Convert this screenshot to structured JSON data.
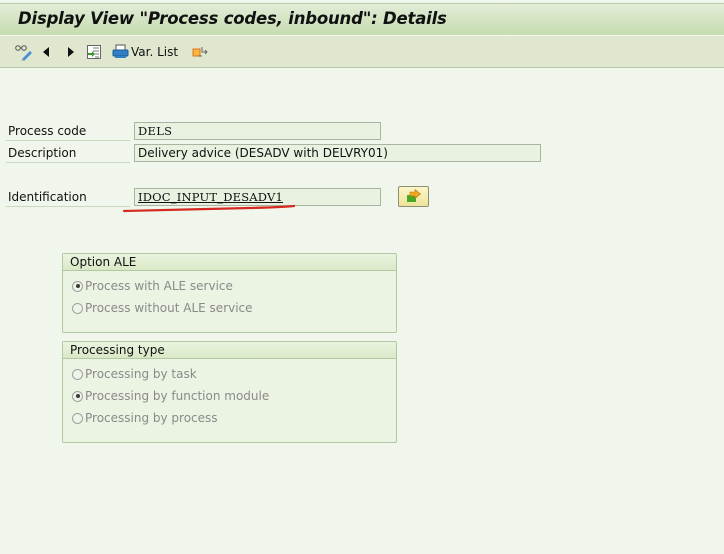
{
  "window": {
    "title": "Display View \"Process codes, inbound\": Details"
  },
  "toolbar": {
    "items": [
      {
        "name": "display-change-toggle",
        "icon": "glasses-pencil-icon"
      },
      {
        "name": "previous-entry",
        "icon": "triangle-left-icon"
      },
      {
        "name": "next-entry",
        "icon": "triangle-right-icon"
      },
      {
        "name": "select-entries",
        "icon": "select-list-icon"
      },
      {
        "name": "variable-list",
        "icon": "printer-icon",
        "label": "Var. List"
      },
      {
        "name": "transport",
        "icon": "transport-export-icon"
      }
    ],
    "var_list_label": "Var. List"
  },
  "form": {
    "process_code": {
      "label": "Process code",
      "value": "DELS"
    },
    "description": {
      "label": "Description",
      "value": "Delivery advice (DESADV with DELVRY01)"
    },
    "identification": {
      "label": "Identification",
      "value": "IDOC_INPUT_DESADV1"
    },
    "navigate_button_icon": "navigate-arrow-icon"
  },
  "groups": {
    "option_ale": {
      "title": "Option ALE",
      "options": [
        {
          "label": "Process with ALE service",
          "selected": true
        },
        {
          "label": "Process without ALE service",
          "selected": false
        }
      ]
    },
    "processing_type": {
      "title": "Processing type",
      "options": [
        {
          "label": "Processing by task",
          "selected": false
        },
        {
          "label": "Processing by function module",
          "selected": true
        },
        {
          "label": "Processing by process",
          "selected": false
        }
      ]
    }
  },
  "annotation": {
    "color": "#d42a22"
  }
}
